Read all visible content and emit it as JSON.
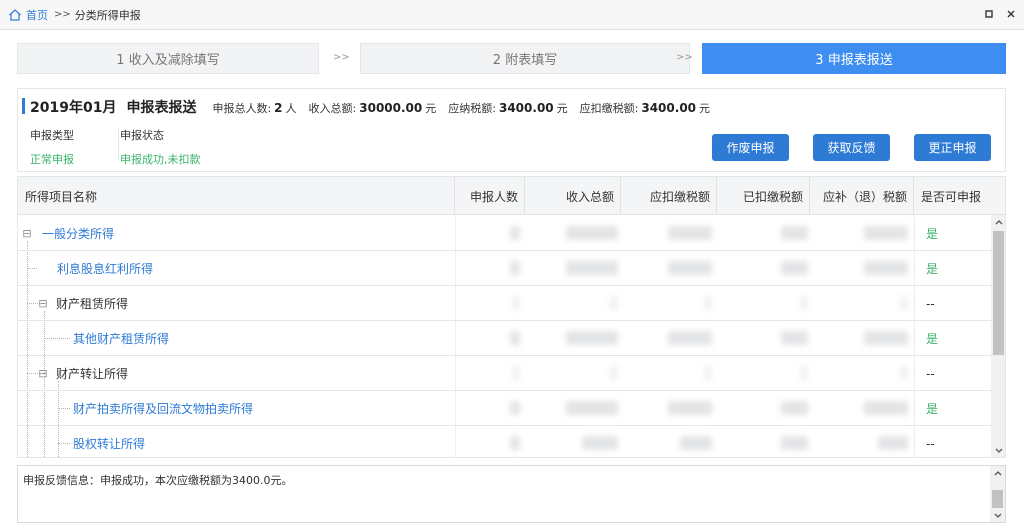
{
  "breadcrumb": {
    "home": "首页",
    "separator": ">>",
    "current": "分类所得申报"
  },
  "window_controls": [
    "restore-icon",
    "close-icon"
  ],
  "steps": [
    {
      "label": "1 收入及减除填写",
      "active": false
    },
    {
      "label": "2 附表填写",
      "active": false
    },
    {
      "label": "3 申报表报送",
      "active": true
    }
  ],
  "step_arrow": ">>",
  "summary": {
    "period": "2019年01月",
    "title": "申报表报送",
    "people_label": "申报总人数:",
    "people_value": "2",
    "people_unit": "人",
    "income_label": "收入总额:",
    "income_value": "30000.00",
    "income_unit": "元",
    "tax_due_label": "应纳税额:",
    "tax_due_value": "3400.00",
    "tax_due_unit": "元",
    "withhold_label": "应扣缴税额:",
    "withhold_value": "3400.00",
    "withhold_unit": "元",
    "type_label": "申报类型",
    "type_value": "正常申报",
    "status_label": "申报状态",
    "status_value": "申报成功,未扣款"
  },
  "actions": {
    "void": "作废申报",
    "feedback": "获取反馈",
    "correct": "更正申报"
  },
  "table": {
    "headers": [
      "所得项目名称",
      "申报人数",
      "收入总额",
      "应扣缴税额",
      "已扣缴税额",
      "应补（退）税额",
      "是否可申报"
    ],
    "rows": [
      {
        "name": "一般分类所得",
        "toggle": "⊟",
        "status": "是"
      },
      {
        "name": "利息股息红利所得",
        "toggle": "",
        "status": "是"
      },
      {
        "name": "财产租赁所得",
        "toggle": "⊟",
        "status": "--"
      },
      {
        "name": "其他财产租赁所得",
        "toggle": "",
        "status": "是"
      },
      {
        "name": "财产转让所得",
        "toggle": "⊟",
        "status": "--"
      },
      {
        "name": "财产拍卖所得及回流文物拍卖所得",
        "toggle": "",
        "status": "是"
      },
      {
        "name": "股权转让所得",
        "toggle": "",
        "status": "--"
      }
    ]
  },
  "feedback": {
    "text": "申报反馈信息：申报成功，本次应缴税额为3400.0元。"
  },
  "colors": {
    "accent": "#2e7bd6",
    "active_step": "#3d8ef0",
    "success": "#3ab36c"
  }
}
